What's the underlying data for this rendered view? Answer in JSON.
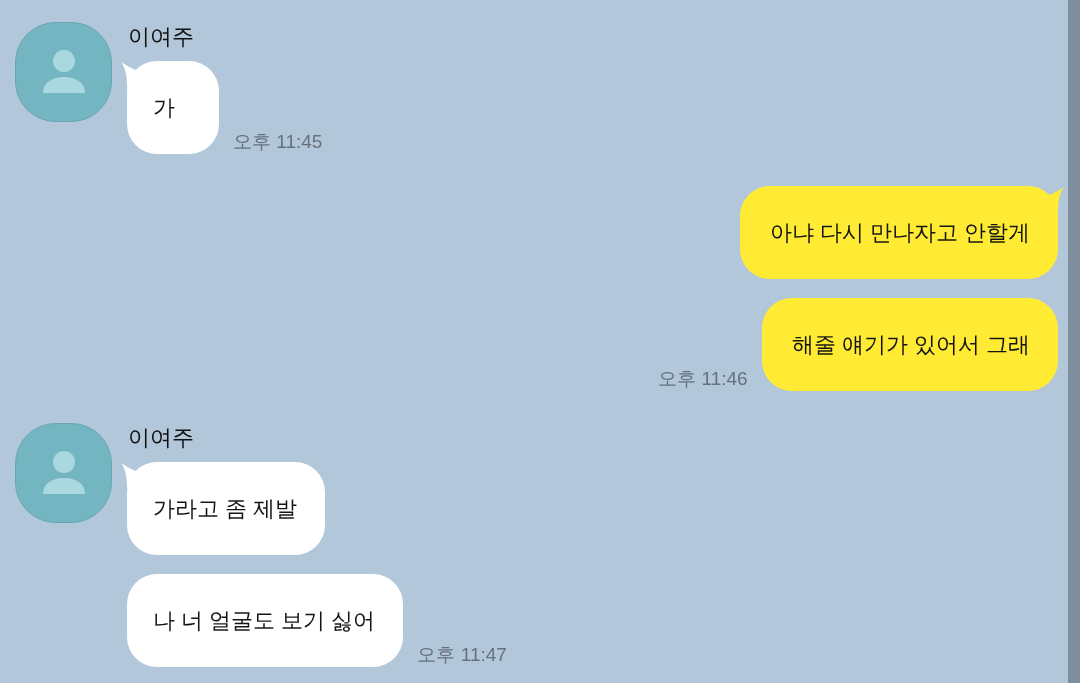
{
  "messages": [
    {
      "kind": "received",
      "sender": "이여주",
      "bubbles": [
        "가"
      ],
      "time": "오후 11:45"
    },
    {
      "kind": "sent",
      "bubbles": [
        "아냐 다시 만나자고 안할게",
        "해줄 얘기가 있어서 그래"
      ],
      "time": "오후 11:46"
    },
    {
      "kind": "received",
      "sender": "이여주",
      "bubbles": [
        "가라고 좀 제발",
        "나 너 얼굴도 보기 싫어"
      ],
      "time": "오후 11:47"
    }
  ]
}
